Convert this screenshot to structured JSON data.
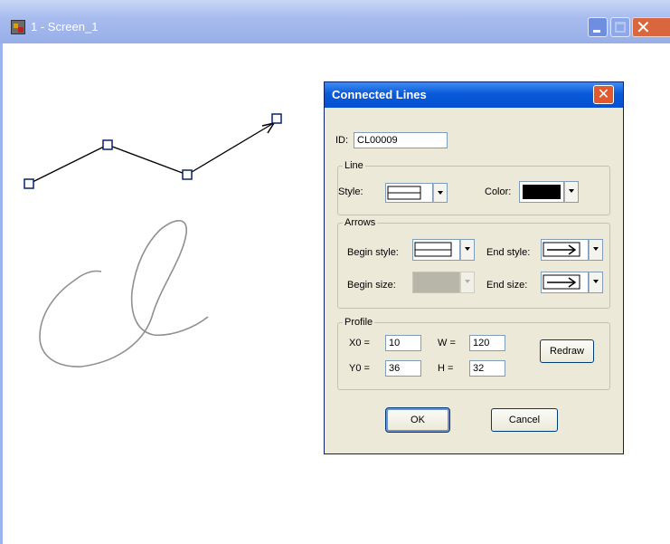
{
  "window": {
    "title": "1 - Screen_1",
    "close_glyph": "✕"
  },
  "dialog": {
    "title": "Connected Lines",
    "close_glyph": "✕",
    "id_label": "ID:",
    "id_value": "CL00009",
    "line_group": {
      "title": "Line",
      "style_label": "Style:",
      "color_label": "Color:",
      "color_value": "#000000"
    },
    "arrows_group": {
      "title": "Arrows",
      "begin_style_label": "Begin style:",
      "end_style_label": "End style:",
      "begin_size_label": "Begin size:",
      "end_size_label": "End size:"
    },
    "profile_group": {
      "title": "Profile",
      "x0_label": "X0 =",
      "x0_value": "10",
      "y0_label": "Y0 =",
      "y0_value": "36",
      "w_label": "W =",
      "w_value": "120",
      "h_label": "H =",
      "h_value": "32",
      "redraw_label": "Redraw"
    },
    "ok_label": "OK",
    "cancel_label": "Cancel"
  },
  "colors": {
    "title_bar": "#a8bcee",
    "dialog_bg": "#ece9d8",
    "handle": "#0a246a",
    "curve": "#909090"
  },
  "icons": {
    "app": "app-icon",
    "minimize": "minimize-icon",
    "maximize": "maximize-icon",
    "close": "close-icon"
  }
}
